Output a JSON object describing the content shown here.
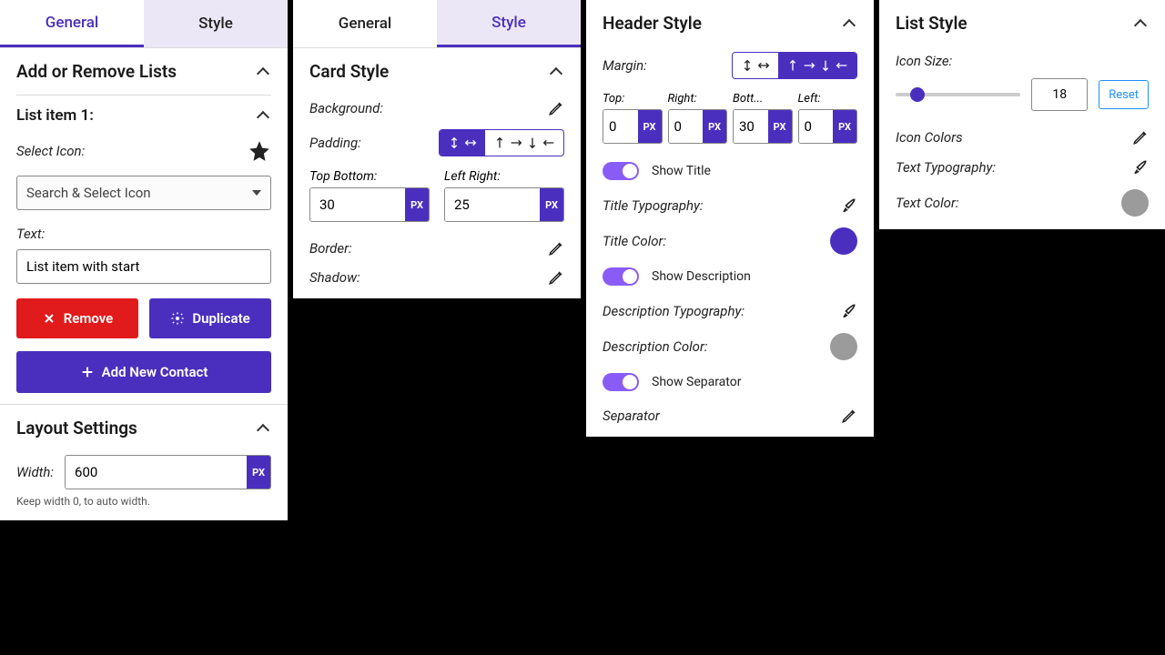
{
  "tabs": {
    "general": "General",
    "style": "Style"
  },
  "panel1": {
    "section_add_remove": "Add or Remove Lists",
    "list_item_title": "List item 1:",
    "select_icon_label": "Select Icon:",
    "select_placeholder": "Search & Select Icon",
    "text_label": "Text:",
    "text_value": "List item with start",
    "remove": "Remove",
    "duplicate": "Duplicate",
    "add_new": "Add New Contact",
    "layout_settings": "Layout Settings",
    "width_label": "Width:",
    "width_value": "600",
    "width_unit": "PX",
    "width_help": "Keep width 0, to auto width."
  },
  "panel2": {
    "card_style": "Card Style",
    "background": "Background:",
    "padding": "Padding:",
    "tb_label": "Top Bottom:",
    "tb_value": "30",
    "lr_label": "Left Right:",
    "lr_value": "25",
    "unit": "PX",
    "border": "Border:",
    "shadow": "Shadow:"
  },
  "panel3": {
    "header_style": "Header Style",
    "margin": "Margin:",
    "top": "Top:",
    "right": "Right:",
    "bottom": "Bott...",
    "left": "Left:",
    "top_v": "0",
    "right_v": "0",
    "bottom_v": "30",
    "left_v": "0",
    "unit": "PX",
    "show_title": "Show Title",
    "title_typo": "Title Typography:",
    "title_color": "Title Color:",
    "title_color_val": "#4a2fbf",
    "show_desc": "Show Description",
    "desc_typo": "Description Typography:",
    "desc_color": "Description Color:",
    "desc_color_val": "#9b9b9b",
    "show_sep": "Show Separator",
    "separator": "Separator"
  },
  "panel4": {
    "list_style": "List Style",
    "icon_size": "Icon Size:",
    "icon_size_val": "18",
    "reset": "Reset",
    "icon_colors": "Icon Colors",
    "text_typo": "Text Typography:",
    "text_color": "Text Color:",
    "text_color_val": "#9b9b9b"
  }
}
